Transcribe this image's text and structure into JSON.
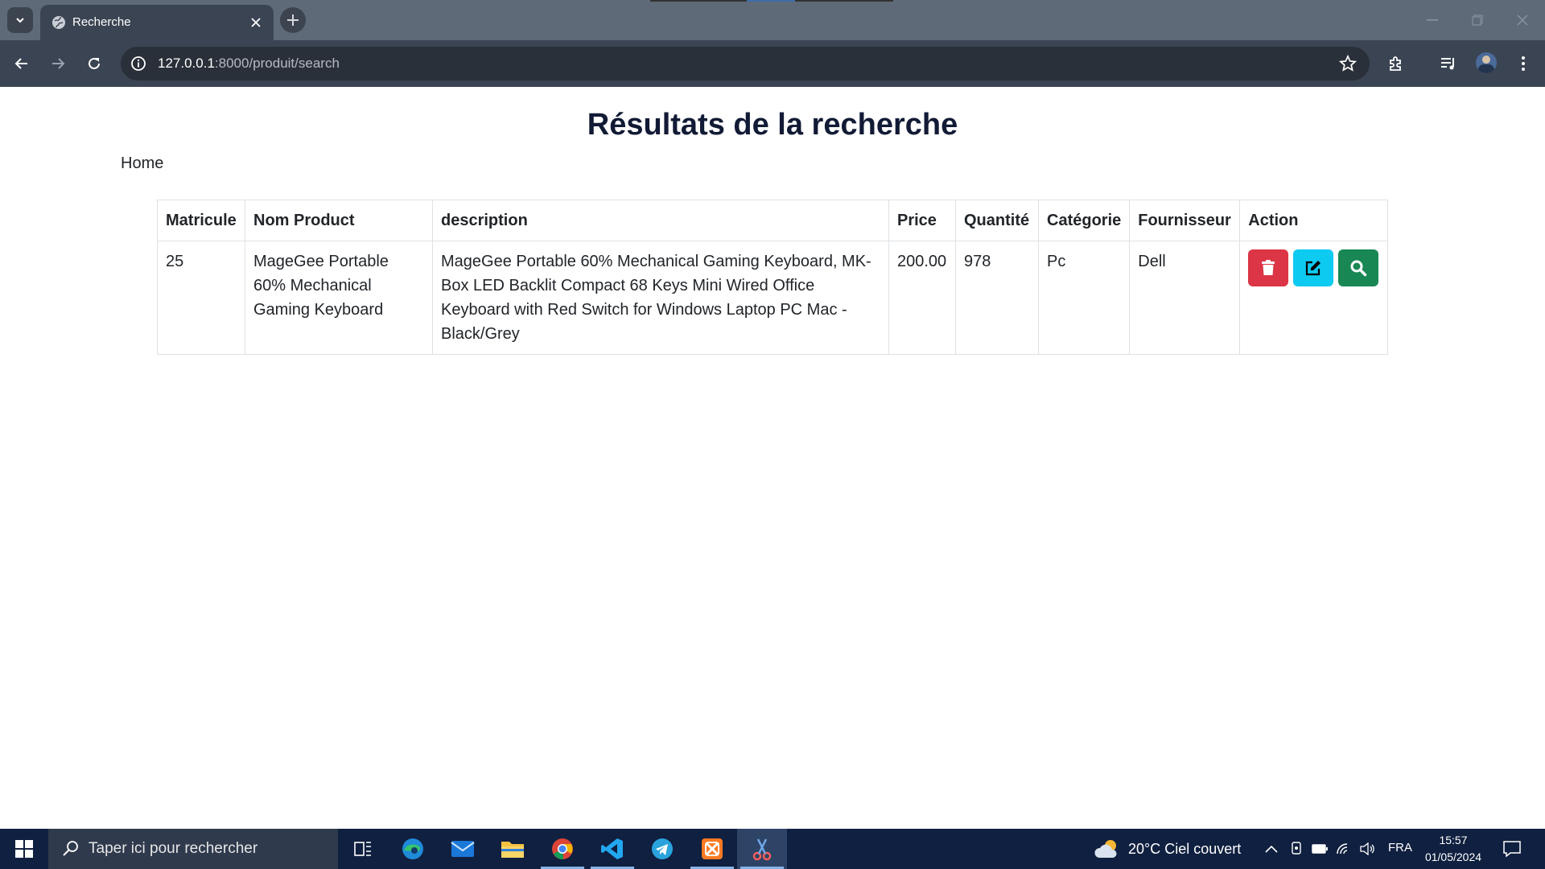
{
  "browser": {
    "tab_title": "Recherche",
    "url_host": "127.0.0.1",
    "url_rest": ":8000/produit/search"
  },
  "page": {
    "heading": "Résultats de la recherche",
    "home_link": "Home",
    "table": {
      "headers": [
        "Matricule",
        "Nom Product",
        "description",
        "Price",
        "Quantité",
        "Catégorie",
        "Fournisseur",
        "Action"
      ],
      "rows": [
        {
          "matricule": "25",
          "nom": "MageGee Portable 60% Mechanical Gaming Keyboard",
          "description": "MageGee Portable 60% Mechanical Gaming Keyboard, MK-Box LED Backlit Compact 68 Keys Mini Wired Office Keyboard with Red Switch for Windows Laptop PC Mac - Black/Grey",
          "price": "200.00",
          "quantite": "978",
          "categorie": "Pc",
          "fournisseur": "Dell"
        }
      ],
      "action_icons": [
        "trash-icon",
        "edit-icon",
        "search-icon"
      ],
      "action_colors": {
        "delete": "#dc3545",
        "edit": "#0dcaf0",
        "show": "#198754"
      }
    }
  },
  "taskbar": {
    "search_placeholder": "Taper ici pour rechercher",
    "weather": "20°C  Ciel couvert",
    "language": "FRA",
    "time": "15:57",
    "date": "01/05/2024"
  }
}
